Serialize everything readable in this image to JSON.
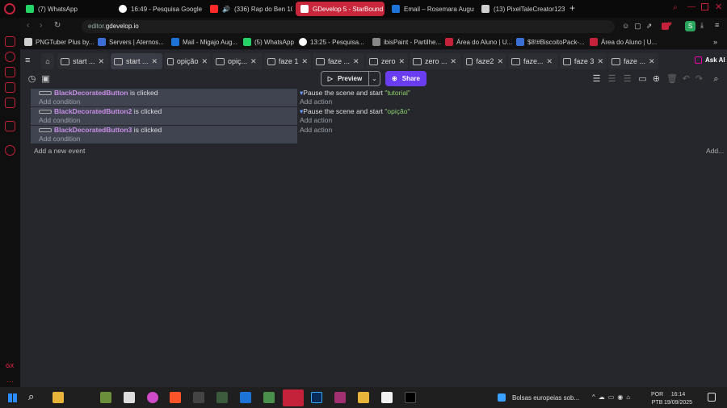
{
  "browser_tabs": [
    {
      "label": "(7) WhatsApp",
      "color": "#25d366"
    },
    {
      "label": "16:49 - Pesquisa Google",
      "color": "#ffffff"
    },
    {
      "label": "(336) Rap do Ben 10 |",
      "color": "#ff2a2a"
    },
    {
      "label": "GDevelop 5 - StarBound",
      "color": "#ffffff",
      "active": true
    },
    {
      "label": "Email – Rosemara August",
      "color": "#1e73d6"
    },
    {
      "label": "(13) PixelTaleCreator123",
      "color": "#cfcfcf"
    }
  ],
  "address": {
    "prefix": "editor.",
    "domain": "gdevelop.io"
  },
  "bookmarks": [
    {
      "label": "PNGTuber Plus by...",
      "color": "#cfcfcf"
    },
    {
      "label": "Servers | Aternos...",
      "color": "#3b6fd6"
    },
    {
      "label": "Mail - Migajo Aug...",
      "color": "#1e73d6"
    },
    {
      "label": "(5) WhatsApp",
      "color": "#25d366"
    },
    {
      "label": "13:25 - Pesquisa...",
      "color": "#ffffff"
    },
    {
      "label": "ibisPaint - Partilhe...",
      "color": "#888888"
    },
    {
      "label": "Área do Aluno | U...",
      "color": "#c4213a"
    },
    {
      "label": "$8!#BiscoitoPack-...",
      "color": "#3b6fd6"
    },
    {
      "label": "Área do Aluno | U...",
      "color": "#c4213a"
    }
  ],
  "gdevelop_tabs": [
    "start ...",
    "start ...",
    "opição",
    "opiç...",
    "faze 1",
    "faze ...",
    "zero",
    "zero ...",
    "faze2",
    "faze...",
    "faze 3",
    "faze ..."
  ],
  "toolbar": {
    "preview": "Preview",
    "share": "Share",
    "ask_ai": "Ask AI"
  },
  "events": [
    {
      "object": "BlackDecoratedButton",
      "condition_suffix": " is clicked",
      "add_condition": "Add condition",
      "action_prefix": "Pause the scene and start ",
      "scene": "\"tutorial\"",
      "add_action": "Add action"
    },
    {
      "object": "BlackDecoratedButton2",
      "condition_suffix": " is clicked",
      "add_condition": "Add condition",
      "action_prefix": "Pause the scene and start ",
      "scene": "\"opição\"",
      "add_action": "Add action"
    },
    {
      "object": "BlackDecoratedButton3",
      "condition_suffix": " is clicked",
      "add_condition": "Add condition",
      "action_prefix": "",
      "scene": "",
      "add_action": "Add action"
    }
  ],
  "add_new_event": "Add a new event",
  "add_more": "Add...",
  "taskbar": {
    "news": "Bolsas europeias sob...",
    "lang1": "POR",
    "lang2": "PTB",
    "time": "16:14",
    "date": "19/09/2025"
  }
}
